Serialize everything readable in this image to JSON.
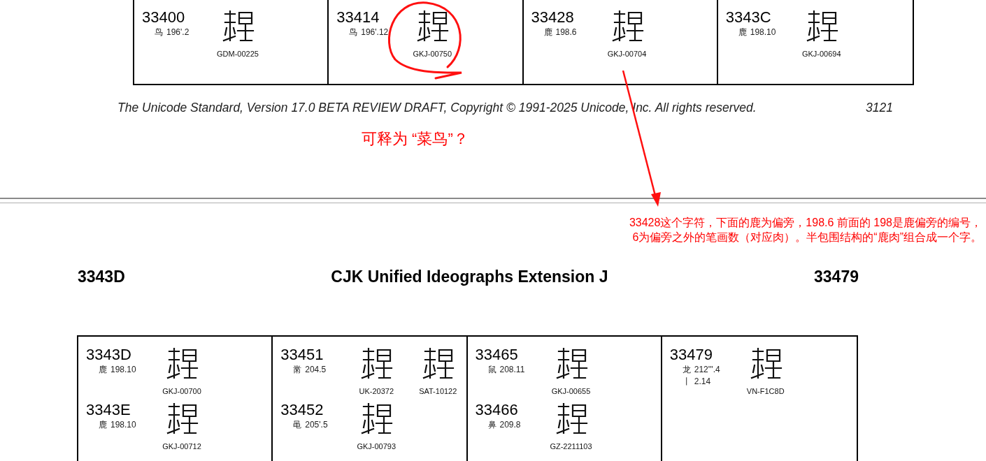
{
  "pages": [
    {
      "columns": [
        {
          "entries": [
            {
              "code": "33400",
              "radicals": [
                {
                  "radical": "鸟",
                  "strokes": "196'.2"
                }
              ],
              "glyphs": [
                {
                  "source": "GDM-00225"
                }
              ]
            }
          ]
        },
        {
          "entries": [
            {
              "code": "33414",
              "radicals": [
                {
                  "radical": "鸟",
                  "strokes": "196'.12"
                }
              ],
              "glyphs": [
                {
                  "source": "GKJ-00750"
                }
              ]
            }
          ]
        },
        {
          "entries": [
            {
              "code": "33428",
              "radicals": [
                {
                  "radical": "鹿",
                  "strokes": "198.6"
                }
              ],
              "glyphs": [
                {
                  "source": "GKJ-00704"
                }
              ]
            }
          ]
        },
        {
          "entries": [
            {
              "code": "3343C",
              "radicals": [
                {
                  "radical": "鹿",
                  "strokes": "198.10"
                }
              ],
              "glyphs": [
                {
                  "source": "GKJ-00694"
                }
              ]
            }
          ]
        }
      ],
      "footer": {
        "text": "The Unicode Standard, Version 17.0 BETA REVIEW DRAFT, Copyright © 1991-2025 Unicode, Inc. All rights reserved.",
        "page_number": "3121"
      },
      "comment": "可释为 “菜鸟”？"
    },
    {
      "note": [
        "33428这个字符，下面的鹿为偏旁，198.6 前面的 198是鹿偏旁的编号，",
        "6为偏旁之外的笔画数（对应肉）。半包围结构的“鹿肉”组合成一个字。"
      ],
      "header": {
        "first": "3343D",
        "title": "CJK Unified Ideographs Extension J",
        "last": "33479"
      },
      "columns": [
        {
          "entries": [
            {
              "code": "3343D",
              "radicals": [
                {
                  "radical": "鹿",
                  "strokes": "198.10"
                }
              ],
              "glyphs": [
                {
                  "source": "GKJ-00700"
                }
              ]
            },
            {
              "code": "3343E",
              "radicals": [
                {
                  "radical": "鹿",
                  "strokes": "198.10"
                }
              ],
              "glyphs": [
                {
                  "source": "GKJ-00712"
                }
              ]
            }
          ]
        },
        {
          "entries": [
            {
              "code": "33451",
              "radicals": [
                {
                  "radical": "黹",
                  "strokes": "204.5"
                }
              ],
              "glyphs": [
                {
                  "source": "UK-20372"
                },
                {
                  "source": "SAT-10122"
                }
              ]
            },
            {
              "code": "33452",
              "radicals": [
                {
                  "radical": "黾",
                  "strokes": "205'.5"
                }
              ],
              "glyphs": [
                {
                  "source": "GKJ-00793"
                }
              ]
            }
          ]
        },
        {
          "entries": [
            {
              "code": "33465",
              "radicals": [
                {
                  "radical": "鼠",
                  "strokes": "208.11"
                }
              ],
              "glyphs": [
                {
                  "source": "GKJ-00655"
                }
              ]
            },
            {
              "code": "33466",
              "radicals": [
                {
                  "radical": "鼻",
                  "strokes": "209.8"
                }
              ],
              "glyphs": [
                {
                  "source": "GZ-2211103"
                }
              ]
            }
          ]
        },
        {
          "entries": [
            {
              "code": "33479",
              "radicals": [
                {
                  "radical": "龙",
                  "strokes": "212'''.4"
                },
                {
                  "radical": "丨",
                  "strokes": "2.14"
                }
              ],
              "glyphs": [
                {
                  "source": "VN-F1C8D"
                }
              ]
            }
          ]
        }
      ]
    }
  ]
}
